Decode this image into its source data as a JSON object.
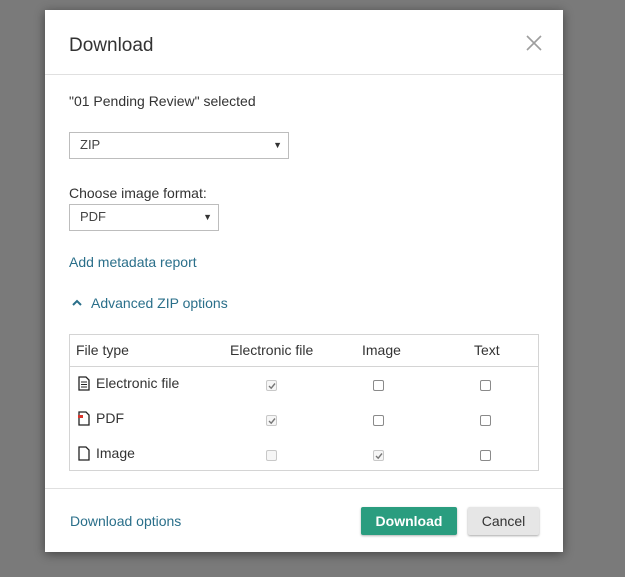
{
  "dialog": {
    "title": "Download",
    "close_icon": "close-icon",
    "selected_text": "\"01 Pending Review\" selected",
    "format_select": {
      "value": "ZIP"
    },
    "image_format_label": "Choose image format:",
    "image_format_select": {
      "value": "PDF"
    },
    "metadata_link": "Add metadata report",
    "advanced_toggle": {
      "label": "Advanced ZIP options",
      "icon": "chevron-up-icon"
    },
    "table": {
      "headers": [
        "File type",
        "Electronic file",
        "Image",
        "Text"
      ],
      "rows": [
        {
          "label": "Electronic file",
          "icon": "electronic-file-icon",
          "electronic": {
            "checked": true,
            "disabled": true
          },
          "image": {
            "checked": false,
            "disabled": false
          },
          "text": {
            "checked": false,
            "disabled": false
          }
        },
        {
          "label": "PDF",
          "icon": "pdf-file-icon",
          "electronic": {
            "checked": true,
            "disabled": true
          },
          "image": {
            "checked": false,
            "disabled": false
          },
          "text": {
            "checked": false,
            "disabled": false
          }
        },
        {
          "label": "Image",
          "icon": "image-file-icon",
          "electronic": {
            "checked": false,
            "disabled": true
          },
          "image": {
            "checked": true,
            "disabled": true
          },
          "text": {
            "checked": false,
            "disabled": false
          }
        }
      ]
    },
    "footer": {
      "options_link": "Download options",
      "download_button": "Download",
      "cancel_button": "Cancel"
    },
    "colors": {
      "primary": "#2a9d7f",
      "link": "#2a6f8a",
      "overlay": "#7a7a7a"
    }
  }
}
